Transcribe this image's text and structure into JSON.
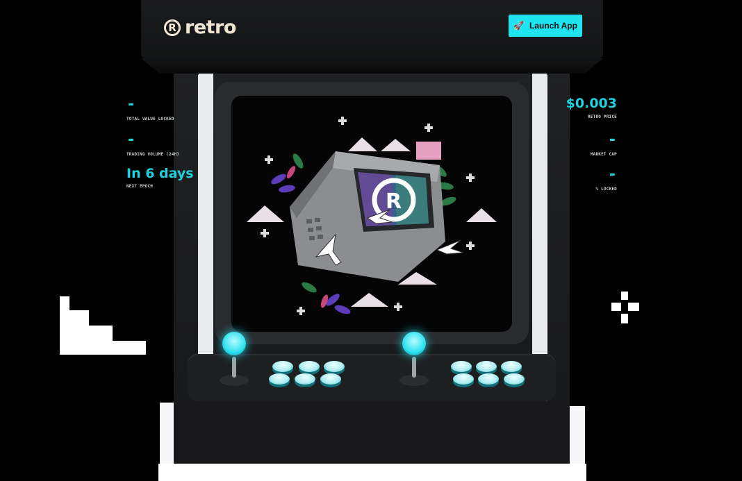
{
  "header": {
    "logo_glyph": "R",
    "logo_text": "retro",
    "launch_label": "Launch App",
    "launch_icon": "rocket-icon"
  },
  "stats_left": [
    {
      "value": "-",
      "label": "TOTAL VALUE LOCKED"
    },
    {
      "value": "-",
      "label": "TRADING VOLUME (24H)"
    },
    {
      "value": "In 6 days",
      "label": "NEXT EPOCH"
    }
  ],
  "stats_right": [
    {
      "value": "$0.003",
      "label": "RETRO PRICE"
    },
    {
      "value": "-",
      "label": "MARKET CAP"
    },
    {
      "value": "-",
      "label": "% LOCKED"
    }
  ],
  "colors": {
    "accent": "#1fe4f0",
    "logo": "#f1e6d2",
    "cabinet": "#1a1b1d",
    "background": "#000000"
  }
}
